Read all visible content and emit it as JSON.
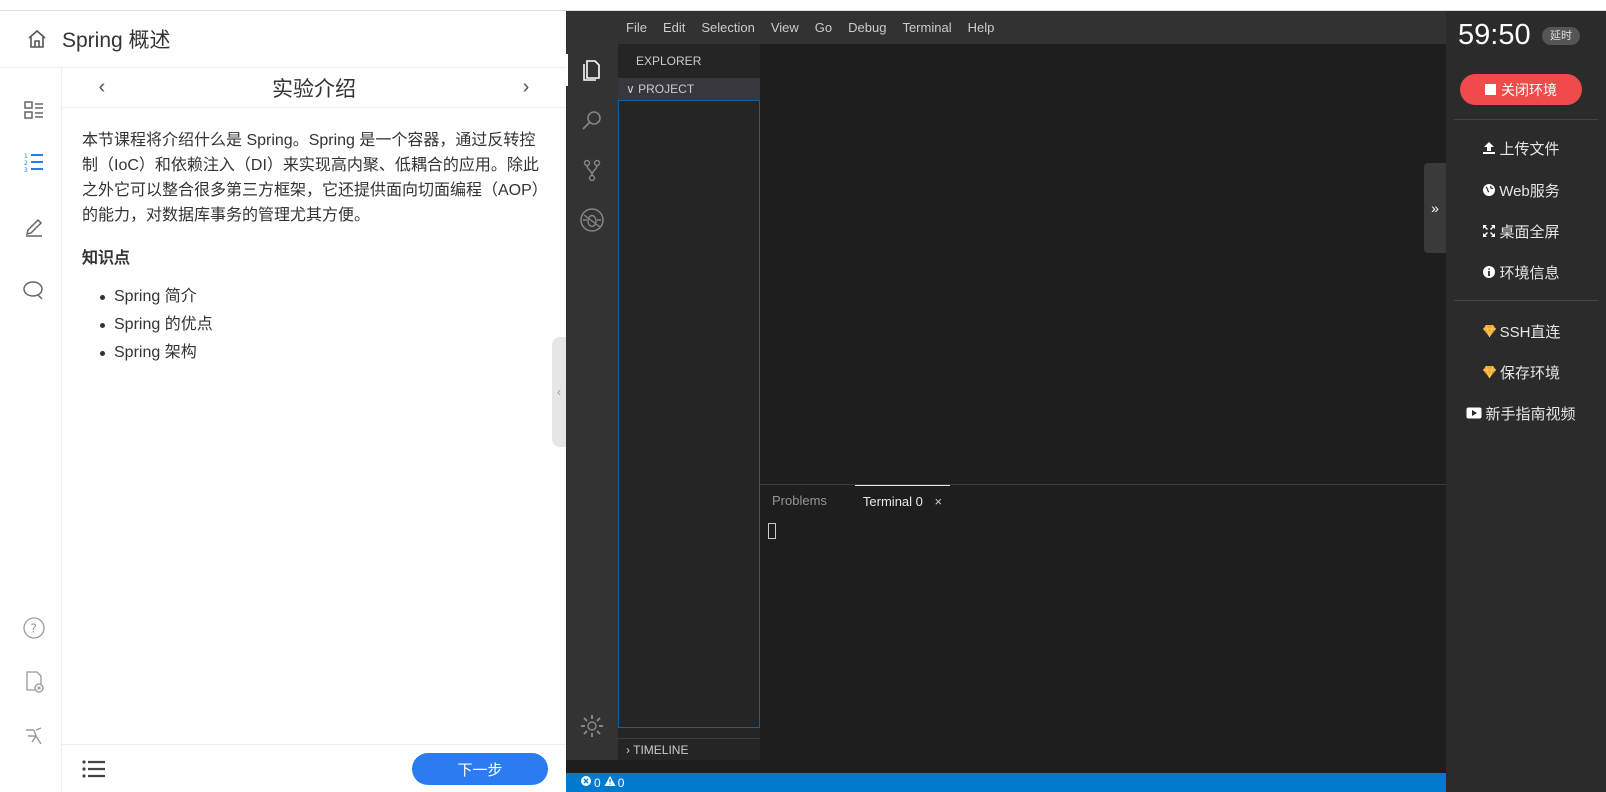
{
  "course": {
    "title": "Spring 概述",
    "step_title": "实验介绍",
    "prev": "‹",
    "next": "›",
    "intro": "本节课程将介绍什么是 Spring。Spring 是一个容器，通过反转控制（IoC）和依赖注入（DI）来实现高内聚、低耦合的应用。除此之外它可以整合很多第三方框架，它还提供面向切面编程（AOP）的能力，对数据库事务的管理尤其方便。",
    "knowledge_heading": "知识点",
    "knowledge_points": [
      "Spring 简介",
      "Spring 的优点",
      "Spring 架构"
    ],
    "next_button": "下一步",
    "rail_icons": [
      "directory-icon",
      "steps-list-icon",
      "notes-pen-icon",
      "comments-icon"
    ],
    "rail_bottom_icons": [
      "help-icon",
      "report-icon",
      "feedback-icon"
    ]
  },
  "vscode": {
    "menu": [
      "File",
      "Edit",
      "Selection",
      "View",
      "Go",
      "Debug",
      "Terminal",
      "Help"
    ],
    "explorer_title": "EXPLORER",
    "project_label": "PROJECT",
    "timeline_label": "TIMELINE",
    "panel_tabs": {
      "problems": "Problems",
      "terminal": "Terminal 0",
      "close": "×"
    },
    "status": {
      "errors": "0",
      "warnings": "0"
    }
  },
  "toolbar": {
    "timer": "59:50",
    "delay_badge": "延时",
    "close_env": "关闭环境",
    "upload": "上传文件",
    "web_service": "Web服务",
    "fullscreen": "桌面全屏",
    "env_info": "环境信息",
    "ssh": "SSH直连",
    "save_env": "保存环境",
    "guide_video": "新手指南视频",
    "expand": "»"
  },
  "colors": {
    "primary_blue": "#2b7cf0",
    "danger_red": "#f04b4b",
    "vscode_status": "#007acc",
    "gem_orange": "#f5a623"
  }
}
